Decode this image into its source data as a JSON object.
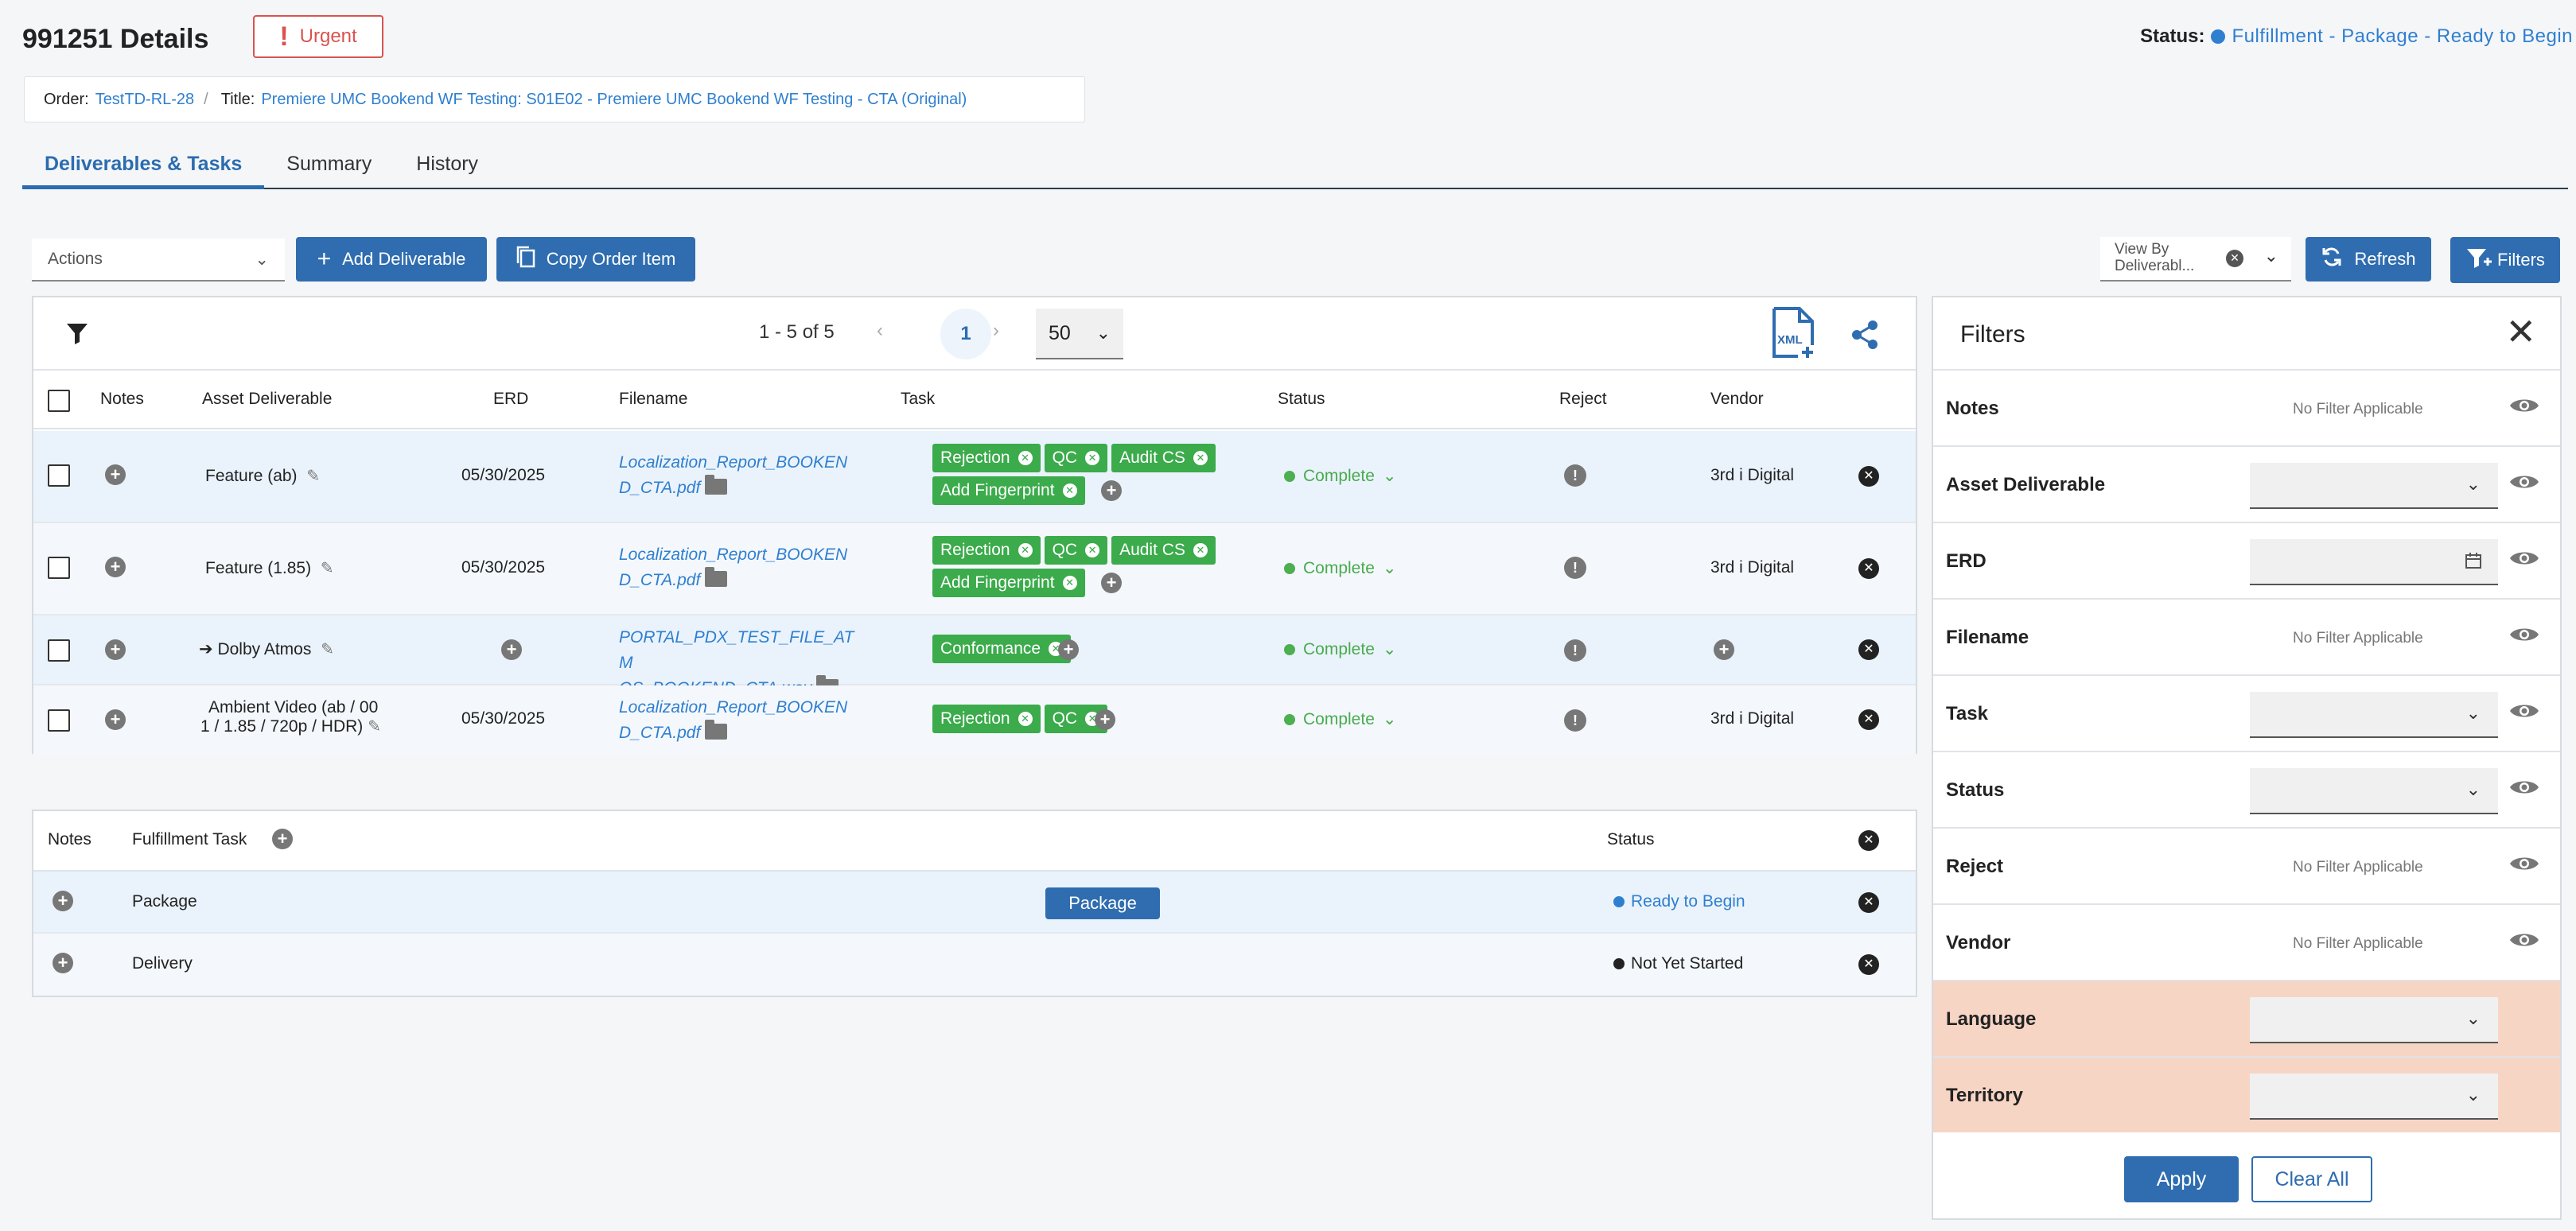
{
  "header": {
    "title": "991251 Details",
    "urgent_label": "Urgent",
    "status_label": "Status:",
    "status_value": "Fulfillment - Package - Ready to Begin",
    "order_label": "Order:",
    "order_value": "TestTD-RL-28",
    "title_label": "Title:",
    "title_value": "Premiere UMC Bookend WF Testing: S01E02 - Premiere UMC Bookend WF Testing - CTA (Original)"
  },
  "tabs": [
    "Deliverables & Tasks",
    "Summary",
    "History"
  ],
  "toolbar": {
    "actions_label": "Actions",
    "add_deliverable": "Add Deliverable",
    "copy_order_item": "Copy Order Item",
    "view_by_line1": "View By",
    "view_by_line2": "Deliverabl...",
    "refresh": "Refresh",
    "filters": "Filters"
  },
  "pager": {
    "count": "1 - 5 of 5",
    "page": "1",
    "per_page": "50",
    "xml_label": "XML"
  },
  "grid": {
    "columns": [
      "Notes",
      "Asset Deliverable",
      "ERD",
      "Filename",
      "Task",
      "Status",
      "Reject",
      "Vendor"
    ],
    "rows": [
      {
        "asset": "Feature (ab)",
        "erd": "05/30/2025",
        "file1": "Localization_Report_BOOKEN",
        "file2": "D_CTA.pdf",
        "tags": [
          "Rejection",
          "QC",
          "Audit CS",
          "Add Fingerprint"
        ],
        "status": "Complete",
        "vendor": "3rd i Digital"
      },
      {
        "asset": "Feature (1.85)",
        "erd": "05/30/2025",
        "file1": "Localization_Report_BOOKEN",
        "file2": "D_CTA.pdf",
        "tags": [
          "Rejection",
          "QC",
          "Audit CS",
          "Add Fingerprint"
        ],
        "status": "Complete",
        "vendor": "3rd i Digital"
      },
      {
        "asset": "Dolby Atmos",
        "erd": "",
        "file1": "PORTAL_PDX_TEST_FILE_ATM",
        "file2": "OS_BOOKEND_CTA.wav",
        "tags": [
          "Conformance"
        ],
        "status": "Complete",
        "vendor": ""
      },
      {
        "asset": "Ambient Video (ab / 00",
        "asset2": "1 / 1.85 / 720p / HDR)",
        "erd": "05/30/2025",
        "file1": "Localization_Report_BOOKEN",
        "file2": "D_CTA.pdf",
        "tags": [
          "Rejection",
          "QC"
        ],
        "status": "Complete",
        "vendor": "3rd i Digital"
      }
    ]
  },
  "fulfillment": {
    "columns": [
      "Notes",
      "Fulfillment Task",
      "Status"
    ],
    "rows": [
      {
        "task": "Package",
        "button": "Package",
        "status": "Ready to Begin"
      },
      {
        "task": "Delivery",
        "button": "",
        "status": "Not Yet Started"
      }
    ]
  },
  "filters_panel": {
    "title": "Filters",
    "rows": [
      {
        "label": "Notes",
        "value": "No Filter Applicable"
      },
      {
        "label": "Asset Deliverable",
        "value": ""
      },
      {
        "label": "ERD",
        "value": ""
      },
      {
        "label": "Filename",
        "value": "No Filter Applicable"
      },
      {
        "label": "Task",
        "value": ""
      },
      {
        "label": "Status",
        "value": ""
      },
      {
        "label": "Reject",
        "value": "No Filter Applicable"
      },
      {
        "label": "Vendor",
        "value": "No Filter Applicable"
      },
      {
        "label": "Language",
        "value": ""
      },
      {
        "label": "Territory",
        "value": ""
      }
    ],
    "apply": "Apply",
    "clear_all": "Clear All"
  },
  "colors": {
    "primary": "#2f6db0",
    "link": "#2f7fd0",
    "urgent": "#d9534f",
    "task_tag": "#3bab4b",
    "highlight_filter": "#f7d5c5"
  }
}
